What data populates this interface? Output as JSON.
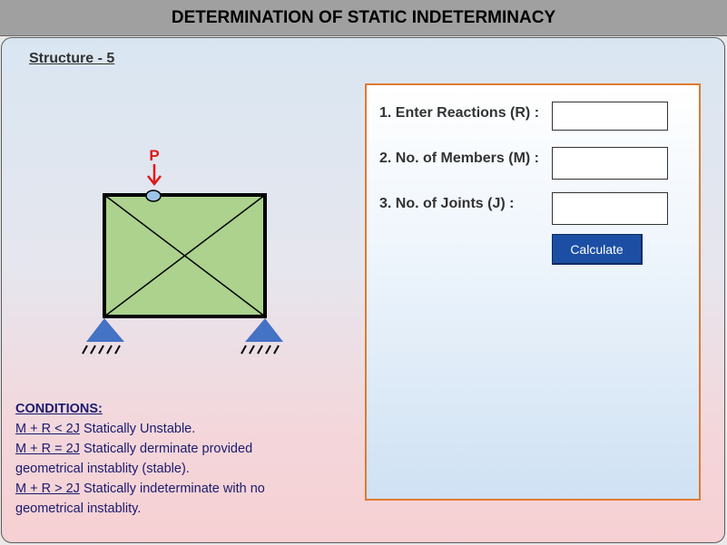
{
  "header": {
    "title": "DETERMINATION OF STATIC INDETERMINACY"
  },
  "structure": {
    "title": "Structure - 5",
    "load_label": "P"
  },
  "conditions": {
    "heading": "CONDITIONS:",
    "items": [
      {
        "formula": "M + R < 2J",
        "text": " Statically Unstable."
      },
      {
        "formula": "M + R = 2J",
        "text": " Statically derminate provided geometrical instablity (stable)."
      },
      {
        "formula": "M + R > 2J",
        "text": " Statically indeterminate with no geometrical instablity."
      }
    ]
  },
  "form": {
    "reactions_label": "1. Enter Reactions (R) :",
    "reactions_value": "",
    "members_label": "2. No. of Members (M) :",
    "members_value": "",
    "joints_label": "3. No. of Joints (J) :",
    "joints_value": "",
    "calculate_label": "Calculate"
  },
  "colors": {
    "frame_fill": "#acd28e",
    "support_fill": "#4472c4",
    "load_arrow": "#e01818",
    "joint_fill": "#9dc3e6",
    "form_border": "#e07a30",
    "button_bg": "#1c4fa3"
  }
}
